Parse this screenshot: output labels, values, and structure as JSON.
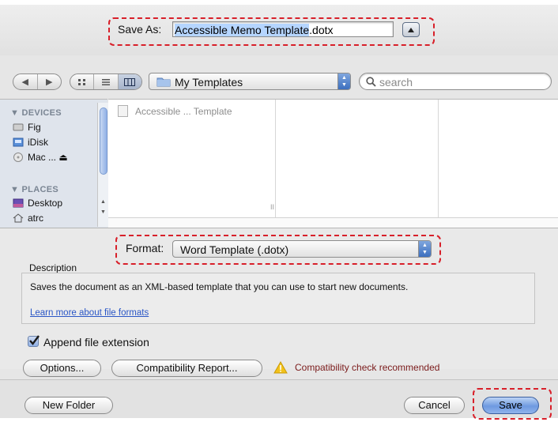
{
  "save_as": {
    "label": "Save As:",
    "filename_selected": "Accessible Memo Template",
    "filename_ext": ".dotx"
  },
  "toolbar": {
    "location": "My Templates",
    "search_placeholder": "search"
  },
  "sidebar": {
    "devices_heading": "DEVICES",
    "devices": [
      "Fig",
      "iDisk",
      "Mac ... ⏏"
    ],
    "places_heading": "PLACES",
    "places": [
      "Desktop",
      "atrc"
    ]
  },
  "file_browser": {
    "items": [
      "Accessible ... Template"
    ],
    "column_marker": "II"
  },
  "format": {
    "label": "Format:",
    "value": "Word Template (.dotx)"
  },
  "description": {
    "label": "Description",
    "text": "Saves the document as an XML-based template that you can use to start new documents.",
    "link": "Learn more about file formats"
  },
  "append_extension": {
    "label": "Append file extension",
    "checked": true
  },
  "buttons": {
    "options": "Options...",
    "compatibility_report": "Compatibility Report...",
    "new_folder": "New Folder",
    "cancel": "Cancel",
    "save": "Save"
  },
  "compatibility_warning": "Compatibility check recommended",
  "colors": {
    "highlight_dash": "#d8202a",
    "selection": "#b5d5ff",
    "accent_blue": "#3c6fbf",
    "link": "#2a56c6",
    "warning_text": "#7a1a1a",
    "warning_icon": "#f2c21a"
  }
}
